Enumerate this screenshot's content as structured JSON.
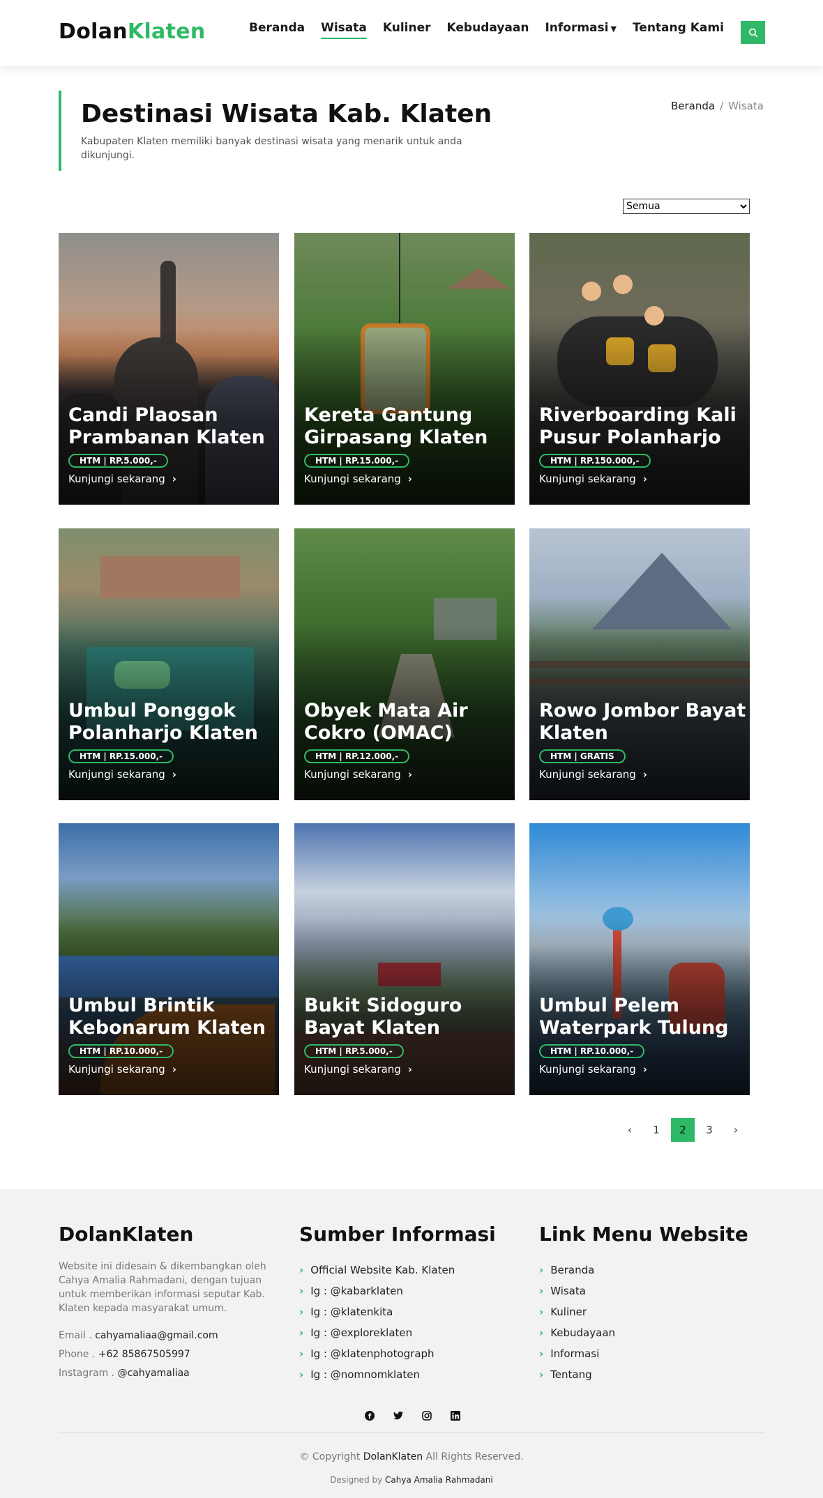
{
  "brand": {
    "part1": "Dolan",
    "part2": "Klaten"
  },
  "nav": {
    "items": [
      {
        "label": "Beranda"
      },
      {
        "label": "Wisata"
      },
      {
        "label": "Kuliner"
      },
      {
        "label": "Kebudayaan"
      },
      {
        "label": "Informasi"
      },
      {
        "label": "Tentang Kami"
      }
    ],
    "search_icon": "search-icon"
  },
  "page": {
    "title": "Destinasi Wisata Kab. Klaten",
    "subtitle": "Kabupaten Klaten memiliki banyak destinasi wisata yang menarik untuk anda dikunjungi."
  },
  "breadcrumb": {
    "home": "Beranda",
    "separator": "/",
    "current": "Wisata"
  },
  "filter": {
    "selected": "Semua"
  },
  "cards": [
    {
      "title": "Candi Plaosan Prambanan Klaten",
      "htm": "HTM | RP.5.000,-",
      "link": "Kunjungi sekarang"
    },
    {
      "title": "Kereta Gantung Girpasang Klaten",
      "htm": "HTM | RP.15.000,-",
      "link": "Kunjungi sekarang"
    },
    {
      "title": "Riverboarding Kali Pusur Polanharjo",
      "htm": "HTM | RP.150.000,-",
      "link": "Kunjungi sekarang"
    },
    {
      "title": "Umbul Ponggok Polanharjo Klaten",
      "htm": "HTM | RP.15.000,-",
      "link": "Kunjungi sekarang"
    },
    {
      "title": "Obyek Mata Air Cokro (OMAC)",
      "htm": "HTM | RP.12.000,-",
      "link": "Kunjungi sekarang"
    },
    {
      "title": "Rowo Jombor Bayat Klaten",
      "htm": "HTM | GRATIS",
      "link": "Kunjungi sekarang"
    },
    {
      "title": "Umbul Brintik Kebonarum Klaten",
      "htm": "HTM | RP.10.000,-",
      "link": "Kunjungi sekarang"
    },
    {
      "title": "Bukit Sidoguro Bayat Klaten",
      "htm": "HTM | RP.5.000,-",
      "link": "Kunjungi sekarang"
    },
    {
      "title": "Umbul Pelem Waterpark Tulung",
      "htm": "HTM | RP.10.000,-",
      "link": "Kunjungi sekarang"
    }
  ],
  "pagination": {
    "prev": "‹",
    "pages": [
      "1",
      "2",
      "3"
    ],
    "active": "2",
    "next": "›"
  },
  "footer": {
    "about": {
      "heading": "DolanKlaten",
      "text": "Website ini didesain & dikembangkan oleh Cahya Amalia Rahmadani, dengan tujuan untuk memberikan informasi seputar Kab. Klaten kepada masyarakat umum.",
      "email_label": "Email .",
      "email": "cahyamaliaa@gmail.com",
      "phone_label": "Phone .",
      "phone": "+62 85867505997",
      "instagram_label": "Instagram .",
      "instagram": "@cahyamaliaa"
    },
    "sources": {
      "heading": "Sumber Informasi",
      "items": [
        "Official Website Kab. Klaten",
        "Ig : @kabarklaten",
        "Ig : @klatenkita",
        "Ig : @exploreklaten",
        "Ig : @klatenphotograph",
        "Ig : @nomnomklaten"
      ]
    },
    "menu": {
      "heading": "Link Menu Website",
      "items": [
        "Beranda",
        "Wisata",
        "Kuliner",
        "Kebudayaan",
        "Informasi",
        "Tentang"
      ]
    },
    "socials": [
      "facebook-icon",
      "twitter-icon",
      "instagram-icon",
      "linkedin-icon"
    ],
    "copyright_prefix": "© Copyright",
    "copyright_brand": "DolanKlaten",
    "copyright_suffix": "All Rights Reserved.",
    "designed_prefix": "Designed by",
    "designed_by": "Cahya Amalia Rahmadani"
  },
  "colors": {
    "accent": "#2fb865"
  }
}
